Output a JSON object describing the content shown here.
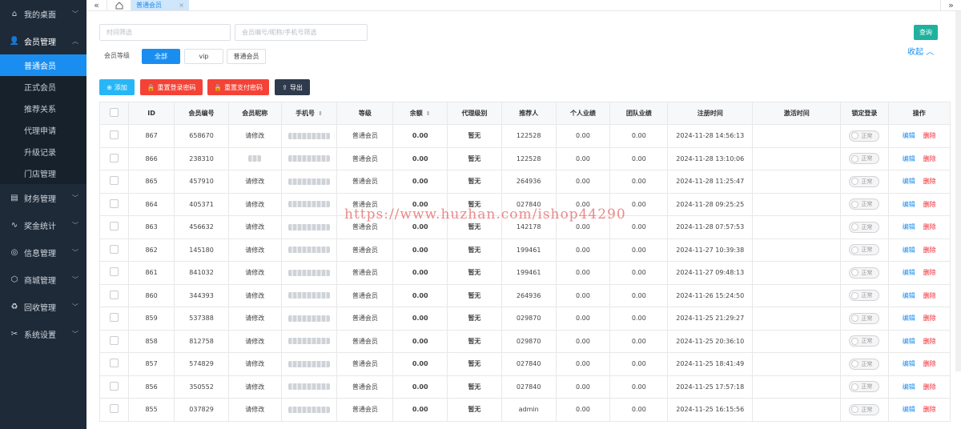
{
  "sidebar": {
    "groups": [
      {
        "label": "我的桌面",
        "icon": "home-icon",
        "open": false
      },
      {
        "label": "会员管理",
        "icon": "user-icon",
        "open": true
      },
      {
        "label": "财务管理",
        "icon": "finance-icon",
        "open": false
      },
      {
        "label": "奖金统计",
        "icon": "chart-icon",
        "open": false
      },
      {
        "label": "信息管理",
        "icon": "info-icon",
        "open": false
      },
      {
        "label": "商城管理",
        "icon": "shop-icon",
        "open": false
      },
      {
        "label": "回收管理",
        "icon": "recycle-icon",
        "open": false
      },
      {
        "label": "系统设置",
        "icon": "settings-icon",
        "open": false
      }
    ],
    "member_items": [
      "普通会员",
      "正式会员",
      "推荐关系",
      "代理申请",
      "升级记录",
      "门店管理"
    ],
    "active_item": "普通会员"
  },
  "tabs": {
    "active_label": "普通会员",
    "close": "×",
    "left_arrow": "«",
    "right_arrow": "»"
  },
  "filters": {
    "time_placeholder": "时间筛选",
    "search_placeholder": "会员编号/昵称/手机号筛选",
    "query_label": "查询",
    "collapse_label": "收起",
    "level_label": "会员等级",
    "level_options": [
      "全部",
      "vip",
      "普通会员"
    ]
  },
  "actions": {
    "add": "添加",
    "reset_login": "重置登录密码",
    "reset_pay": "重置支付密码",
    "export": "导出"
  },
  "table": {
    "headers": [
      "ID",
      "会员编号",
      "会员昵称",
      "手机号",
      "等级",
      "余额",
      "代理级别",
      "推荐人",
      "个人业绩",
      "团队业绩",
      "注册时间",
      "激活时间",
      "锁定登录",
      "操作"
    ],
    "toggle_label": "正常",
    "edit_label": "编辑",
    "delete_label": "删除",
    "rows": [
      {
        "id": "867",
        "no": "658670",
        "nick": "请修改",
        "level": "普通会员",
        "balance": "0.00",
        "agent": "暂无",
        "ref": "122528",
        "personal": "0.00",
        "team": "0.00",
        "reg": "2024-11-28 14:56:13",
        "act": ""
      },
      {
        "id": "866",
        "no": "238310",
        "nick": "",
        "level": "普通会员",
        "balance": "0.00",
        "agent": "暂无",
        "ref": "122528",
        "personal": "0.00",
        "team": "0.00",
        "reg": "2024-11-28 13:10:06",
        "act": ""
      },
      {
        "id": "865",
        "no": "457910",
        "nick": "请修改",
        "level": "普通会员",
        "balance": "0.00",
        "agent": "暂无",
        "ref": "264936",
        "personal": "0.00",
        "team": "0.00",
        "reg": "2024-11-28 11:25:47",
        "act": ""
      },
      {
        "id": "864",
        "no": "405371",
        "nick": "请修改",
        "level": "普通会员",
        "balance": "0.00",
        "agent": "暂无",
        "ref": "027840",
        "personal": "0.00",
        "team": "0.00",
        "reg": "2024-11-28 09:25:25",
        "act": ""
      },
      {
        "id": "863",
        "no": "456632",
        "nick": "请修改",
        "level": "普通会员",
        "balance": "0.00",
        "agent": "暂无",
        "ref": "142178",
        "personal": "0.00",
        "team": "0.00",
        "reg": "2024-11-28 07:57:53",
        "act": ""
      },
      {
        "id": "862",
        "no": "145180",
        "nick": "请修改",
        "level": "普通会员",
        "balance": "0.00",
        "agent": "暂无",
        "ref": "199461",
        "personal": "0.00",
        "team": "0.00",
        "reg": "2024-11-27 10:39:38",
        "act": ""
      },
      {
        "id": "861",
        "no": "841032",
        "nick": "请修改",
        "level": "普通会员",
        "balance": "0.00",
        "agent": "暂无",
        "ref": "199461",
        "personal": "0.00",
        "team": "0.00",
        "reg": "2024-11-27 09:48:13",
        "act": ""
      },
      {
        "id": "860",
        "no": "344393",
        "nick": "请修改",
        "level": "普通会员",
        "balance": "0.00",
        "agent": "暂无",
        "ref": "264936",
        "personal": "0.00",
        "team": "0.00",
        "reg": "2024-11-26 15:24:50",
        "act": ""
      },
      {
        "id": "859",
        "no": "537388",
        "nick": "请修改",
        "level": "普通会员",
        "balance": "0.00",
        "agent": "暂无",
        "ref": "029870",
        "personal": "0.00",
        "team": "0.00",
        "reg": "2024-11-25 21:29:27",
        "act": ""
      },
      {
        "id": "858",
        "no": "812758",
        "nick": "请修改",
        "level": "普通会员",
        "balance": "0.00",
        "agent": "暂无",
        "ref": "029870",
        "personal": "0.00",
        "team": "0.00",
        "reg": "2024-11-25 20:36:10",
        "act": ""
      },
      {
        "id": "857",
        "no": "574829",
        "nick": "请修改",
        "level": "普通会员",
        "balance": "0.00",
        "agent": "暂无",
        "ref": "027840",
        "personal": "0.00",
        "team": "0.00",
        "reg": "2024-11-25 18:41:49",
        "act": ""
      },
      {
        "id": "856",
        "no": "350552",
        "nick": "请修改",
        "level": "普通会员",
        "balance": "0.00",
        "agent": "暂无",
        "ref": "027840",
        "personal": "0.00",
        "team": "0.00",
        "reg": "2024-11-25 17:57:18",
        "act": ""
      },
      {
        "id": "855",
        "no": "037829",
        "nick": "请修改",
        "level": "普通会员",
        "balance": "0.00",
        "agent": "暂无",
        "ref": "admin",
        "personal": "0.00",
        "team": "0.00",
        "reg": "2024-11-25 16:15:56",
        "act": ""
      }
    ]
  },
  "watermark": "https://www.huzhan.com/ishop44290",
  "colors": {
    "sidebar": "#1e2a38",
    "accent": "#1a8ef0",
    "query": "#1fb19d",
    "add": "#29b6f6",
    "danger": "#f44336",
    "export": "#2f3b4c"
  }
}
